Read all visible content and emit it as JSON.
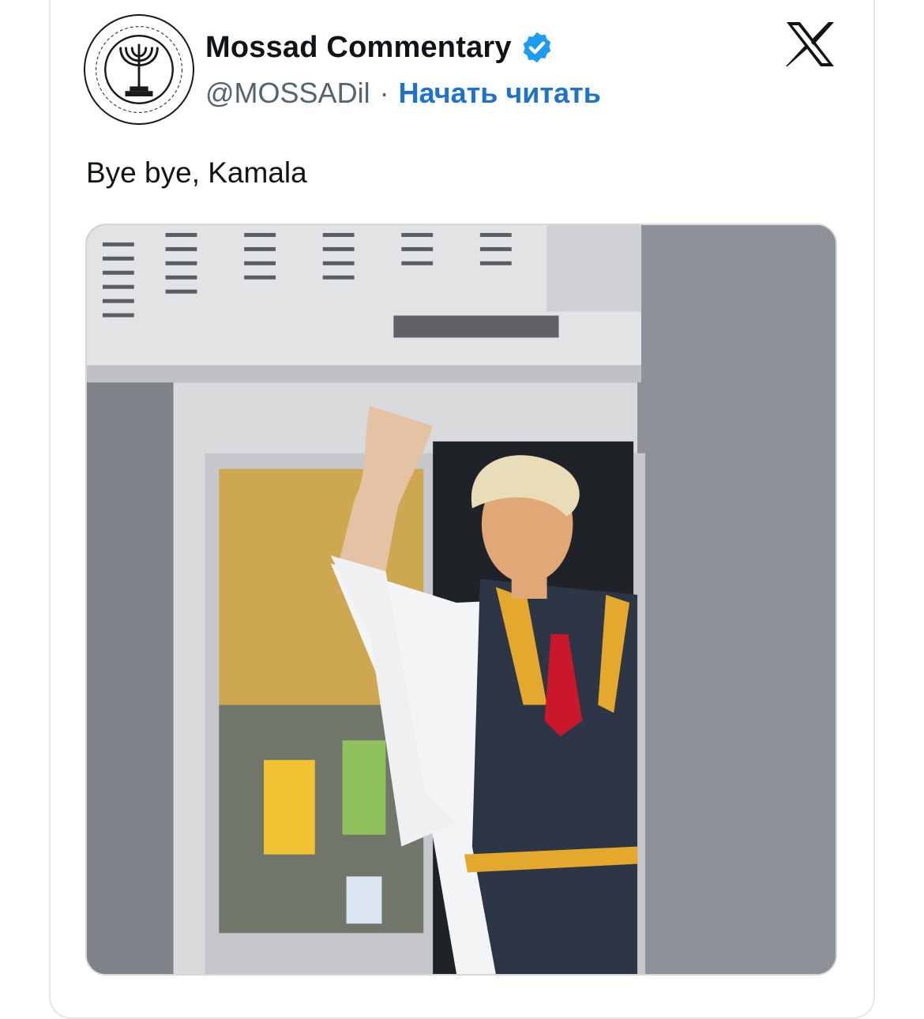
{
  "tweet": {
    "author": {
      "display_name": "Mossad Commentary",
      "handle": "@MOSSADil",
      "verified": true,
      "avatar_icon": "menorah-emblem-icon"
    },
    "separator": "·",
    "follow_label": "Начать читать",
    "platform_icon": "x-logo-icon",
    "text": "Bye bye, Kamala",
    "media": {
      "type": "photo",
      "alt": "A man in a white shirt, red tie and dark apron with yellow trim waving from a drive-thru window"
    }
  },
  "colors": {
    "text_primary": "#0f1419",
    "text_secondary": "#536471",
    "link_blue": "#1d72c9",
    "verified_blue": "#1d9bf0"
  }
}
